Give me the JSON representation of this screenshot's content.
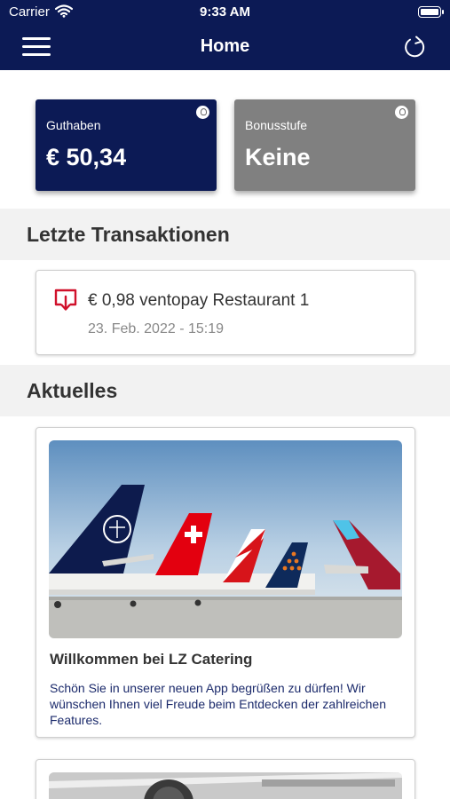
{
  "status_bar": {
    "carrier": "Carrier",
    "time": "9:33 AM"
  },
  "nav": {
    "title": "Home"
  },
  "cards": {
    "balance": {
      "label": "Guthaben",
      "value": "€ 50,34"
    },
    "bonus": {
      "label": "Bonusstufe",
      "value": "Keine"
    }
  },
  "sections": {
    "transactions": "Letzte Transaktionen",
    "news": "Aktuelles"
  },
  "transactions": [
    {
      "title": "€ 0,98 ventopay Restaurant 1",
      "date": "23. Feb. 2022 - 15:19"
    }
  ],
  "news": [
    {
      "title": "Willkommen bei LZ Catering",
      "text": "Schön Sie in unserer neuen App begrüßen zu dürfen! Wir wünschen Ihnen viel Freude beim Entdecken der zahlreichen Features."
    }
  ],
  "colors": {
    "brand_navy": "#0c1a55",
    "bonus_gray": "#808080",
    "tx_red": "#d0112b"
  }
}
